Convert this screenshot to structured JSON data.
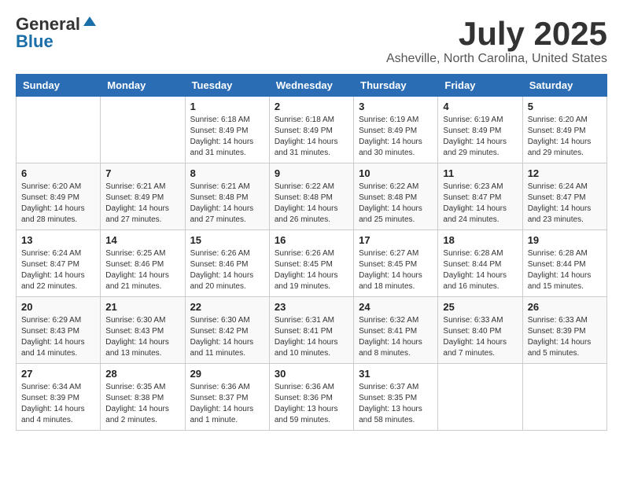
{
  "logo": {
    "general": "General",
    "blue": "Blue"
  },
  "title": "July 2025",
  "subtitle": "Asheville, North Carolina, United States",
  "days_of_week": [
    "Sunday",
    "Monday",
    "Tuesday",
    "Wednesday",
    "Thursday",
    "Friday",
    "Saturday"
  ],
  "weeks": [
    [
      {
        "day": "",
        "info": ""
      },
      {
        "day": "",
        "info": ""
      },
      {
        "day": "1",
        "info": "Sunrise: 6:18 AM\nSunset: 8:49 PM\nDaylight: 14 hours and 31 minutes."
      },
      {
        "day": "2",
        "info": "Sunrise: 6:18 AM\nSunset: 8:49 PM\nDaylight: 14 hours and 31 minutes."
      },
      {
        "day": "3",
        "info": "Sunrise: 6:19 AM\nSunset: 8:49 PM\nDaylight: 14 hours and 30 minutes."
      },
      {
        "day": "4",
        "info": "Sunrise: 6:19 AM\nSunset: 8:49 PM\nDaylight: 14 hours and 29 minutes."
      },
      {
        "day": "5",
        "info": "Sunrise: 6:20 AM\nSunset: 8:49 PM\nDaylight: 14 hours and 29 minutes."
      }
    ],
    [
      {
        "day": "6",
        "info": "Sunrise: 6:20 AM\nSunset: 8:49 PM\nDaylight: 14 hours and 28 minutes."
      },
      {
        "day": "7",
        "info": "Sunrise: 6:21 AM\nSunset: 8:49 PM\nDaylight: 14 hours and 27 minutes."
      },
      {
        "day": "8",
        "info": "Sunrise: 6:21 AM\nSunset: 8:48 PM\nDaylight: 14 hours and 27 minutes."
      },
      {
        "day": "9",
        "info": "Sunrise: 6:22 AM\nSunset: 8:48 PM\nDaylight: 14 hours and 26 minutes."
      },
      {
        "day": "10",
        "info": "Sunrise: 6:22 AM\nSunset: 8:48 PM\nDaylight: 14 hours and 25 minutes."
      },
      {
        "day": "11",
        "info": "Sunrise: 6:23 AM\nSunset: 8:47 PM\nDaylight: 14 hours and 24 minutes."
      },
      {
        "day": "12",
        "info": "Sunrise: 6:24 AM\nSunset: 8:47 PM\nDaylight: 14 hours and 23 minutes."
      }
    ],
    [
      {
        "day": "13",
        "info": "Sunrise: 6:24 AM\nSunset: 8:47 PM\nDaylight: 14 hours and 22 minutes."
      },
      {
        "day": "14",
        "info": "Sunrise: 6:25 AM\nSunset: 8:46 PM\nDaylight: 14 hours and 21 minutes."
      },
      {
        "day": "15",
        "info": "Sunrise: 6:26 AM\nSunset: 8:46 PM\nDaylight: 14 hours and 20 minutes."
      },
      {
        "day": "16",
        "info": "Sunrise: 6:26 AM\nSunset: 8:45 PM\nDaylight: 14 hours and 19 minutes."
      },
      {
        "day": "17",
        "info": "Sunrise: 6:27 AM\nSunset: 8:45 PM\nDaylight: 14 hours and 18 minutes."
      },
      {
        "day": "18",
        "info": "Sunrise: 6:28 AM\nSunset: 8:44 PM\nDaylight: 14 hours and 16 minutes."
      },
      {
        "day": "19",
        "info": "Sunrise: 6:28 AM\nSunset: 8:44 PM\nDaylight: 14 hours and 15 minutes."
      }
    ],
    [
      {
        "day": "20",
        "info": "Sunrise: 6:29 AM\nSunset: 8:43 PM\nDaylight: 14 hours and 14 minutes."
      },
      {
        "day": "21",
        "info": "Sunrise: 6:30 AM\nSunset: 8:43 PM\nDaylight: 14 hours and 13 minutes."
      },
      {
        "day": "22",
        "info": "Sunrise: 6:30 AM\nSunset: 8:42 PM\nDaylight: 14 hours and 11 minutes."
      },
      {
        "day": "23",
        "info": "Sunrise: 6:31 AM\nSunset: 8:41 PM\nDaylight: 14 hours and 10 minutes."
      },
      {
        "day": "24",
        "info": "Sunrise: 6:32 AM\nSunset: 8:41 PM\nDaylight: 14 hours and 8 minutes."
      },
      {
        "day": "25",
        "info": "Sunrise: 6:33 AM\nSunset: 8:40 PM\nDaylight: 14 hours and 7 minutes."
      },
      {
        "day": "26",
        "info": "Sunrise: 6:33 AM\nSunset: 8:39 PM\nDaylight: 14 hours and 5 minutes."
      }
    ],
    [
      {
        "day": "27",
        "info": "Sunrise: 6:34 AM\nSunset: 8:39 PM\nDaylight: 14 hours and 4 minutes."
      },
      {
        "day": "28",
        "info": "Sunrise: 6:35 AM\nSunset: 8:38 PM\nDaylight: 14 hours and 2 minutes."
      },
      {
        "day": "29",
        "info": "Sunrise: 6:36 AM\nSunset: 8:37 PM\nDaylight: 14 hours and 1 minute."
      },
      {
        "day": "30",
        "info": "Sunrise: 6:36 AM\nSunset: 8:36 PM\nDaylight: 13 hours and 59 minutes."
      },
      {
        "day": "31",
        "info": "Sunrise: 6:37 AM\nSunset: 8:35 PM\nDaylight: 13 hours and 58 minutes."
      },
      {
        "day": "",
        "info": ""
      },
      {
        "day": "",
        "info": ""
      }
    ]
  ]
}
